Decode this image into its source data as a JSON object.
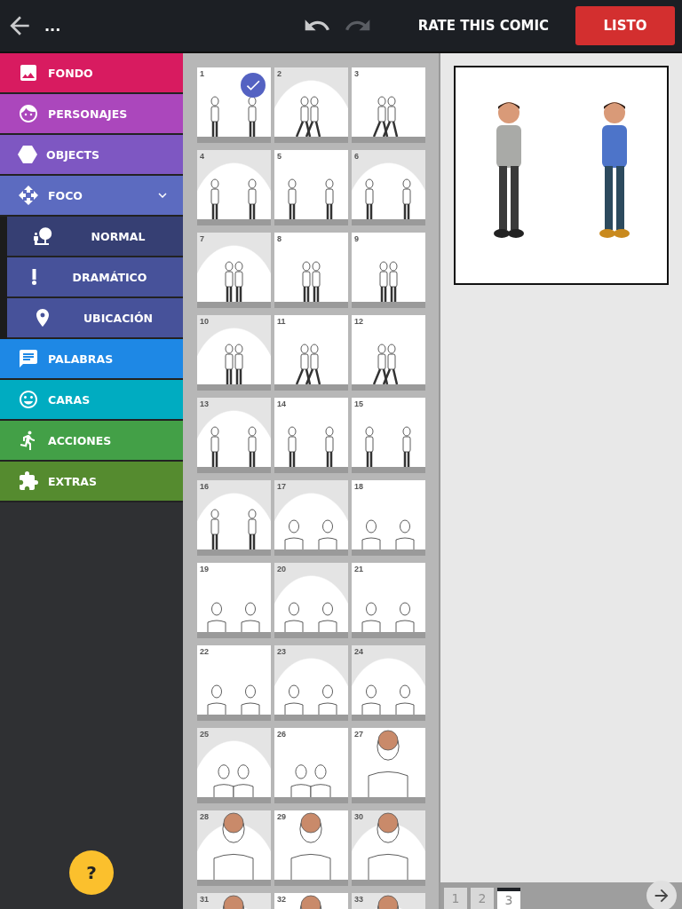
{
  "top_bar": {
    "title": "...",
    "redo_disabled": true,
    "rate_link": "RATE THIS COMIC",
    "done_button": "LISTO"
  },
  "sidebar": {
    "items": [
      {
        "label": "FONDO",
        "color": "#d81b60"
      },
      {
        "label": "PERSONAJES",
        "color": "#ab47bc"
      },
      {
        "label": "OBJECTS",
        "color": "#7e57c2"
      },
      {
        "label": "FOCO",
        "color": "#5c6bc0",
        "expanded": true,
        "children": [
          {
            "label": "NORMAL",
            "selected": true
          },
          {
            "label": "DRAMÁTICO",
            "selected": false
          },
          {
            "label": "UBICACIÓN",
            "selected": false
          }
        ]
      },
      {
        "label": "PALABRAS",
        "color": "#1e88e5"
      },
      {
        "label": "CARAS",
        "color": "#00acc1"
      },
      {
        "label": "ACCIONES",
        "color": "#43a047"
      },
      {
        "label": "EXTRAS",
        "color": "#558b2f"
      }
    ]
  },
  "help_button": "?",
  "layouts": [
    {
      "number": "1",
      "kind": "apart",
      "spotlight": false,
      "selected": true
    },
    {
      "number": "2",
      "kind": "walking",
      "spotlight": true,
      "selected": false
    },
    {
      "number": "3",
      "kind": "walking",
      "spotlight": false,
      "selected": false
    },
    {
      "number": "4",
      "kind": "apart",
      "spotlight": true,
      "selected": false
    },
    {
      "number": "5",
      "kind": "apart",
      "spotlight": false,
      "selected": false
    },
    {
      "number": "6",
      "kind": "apart",
      "spotlight": true,
      "selected": false
    },
    {
      "number": "7",
      "kind": "pair",
      "spotlight": true,
      "selected": false
    },
    {
      "number": "8",
      "kind": "pair",
      "spotlight": false,
      "selected": false
    },
    {
      "number": "9",
      "kind": "pair",
      "spotlight": false,
      "selected": false
    },
    {
      "number": "10",
      "kind": "pair",
      "spotlight": true,
      "selected": false
    },
    {
      "number": "11",
      "kind": "walking",
      "spotlight": false,
      "selected": false
    },
    {
      "number": "12",
      "kind": "walking",
      "spotlight": false,
      "selected": false
    },
    {
      "number": "13",
      "kind": "apart",
      "spotlight": true,
      "selected": false
    },
    {
      "number": "14",
      "kind": "apart",
      "spotlight": false,
      "selected": false
    },
    {
      "number": "15",
      "kind": "apart",
      "spotlight": false,
      "selected": false
    },
    {
      "number": "16",
      "kind": "apart",
      "spotlight": true,
      "selected": false
    },
    {
      "number": "17",
      "kind": "busts",
      "spotlight": true,
      "selected": false
    },
    {
      "number": "18",
      "kind": "busts",
      "spotlight": false,
      "selected": false
    },
    {
      "number": "19",
      "kind": "busts",
      "spotlight": false,
      "selected": false
    },
    {
      "number": "20",
      "kind": "busts",
      "spotlight": true,
      "selected": false
    },
    {
      "number": "21",
      "kind": "busts",
      "spotlight": false,
      "selected": false
    },
    {
      "number": "22",
      "kind": "busts",
      "spotlight": false,
      "selected": false
    },
    {
      "number": "23",
      "kind": "busts",
      "spotlight": true,
      "selected": false
    },
    {
      "number": "24",
      "kind": "busts",
      "spotlight": true,
      "selected": false
    },
    {
      "number": "25",
      "kind": "close-pair",
      "spotlight": true,
      "selected": false
    },
    {
      "number": "26",
      "kind": "close-pair",
      "spotlight": false,
      "selected": false
    },
    {
      "number": "27",
      "kind": "closeup",
      "spotlight": false,
      "selected": false
    },
    {
      "number": "28",
      "kind": "closeup",
      "spotlight": true,
      "selected": false
    },
    {
      "number": "29",
      "kind": "closeup",
      "spotlight": false,
      "selected": false
    },
    {
      "number": "30",
      "kind": "closeup",
      "spotlight": true,
      "selected": false
    },
    {
      "number": "31",
      "kind": "closeup",
      "spotlight": true,
      "selected": false
    },
    {
      "number": "32",
      "kind": "closeup",
      "spotlight": false,
      "selected": false
    },
    {
      "number": "33",
      "kind": "closeup",
      "spotlight": true,
      "selected": false
    }
  ],
  "pages": [
    {
      "label": "1",
      "selected": false
    },
    {
      "label": "2",
      "selected": false
    },
    {
      "label": "3",
      "selected": true
    }
  ]
}
